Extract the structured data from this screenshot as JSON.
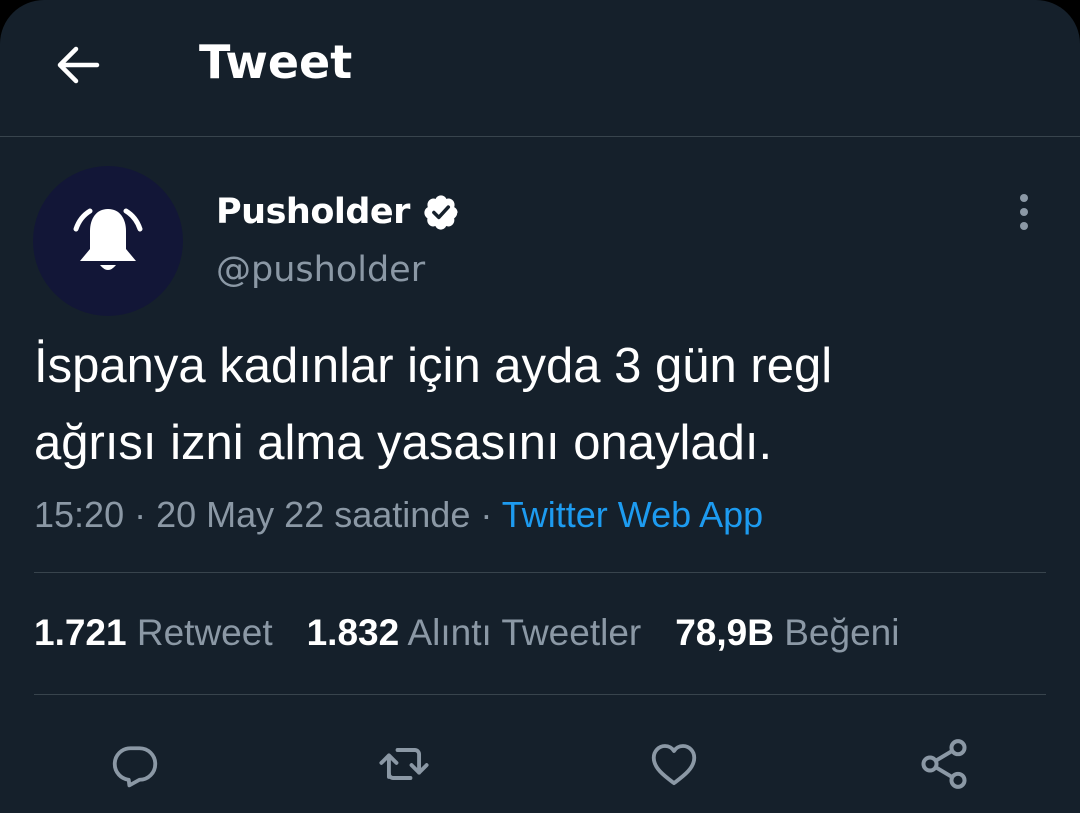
{
  "header": {
    "title": "Tweet",
    "back_icon": "arrow-left-icon"
  },
  "author": {
    "display_name": "Pusholder",
    "handle": "@pusholder",
    "verified": true,
    "avatar_icon": "bell-icon",
    "avatar_bg": "#121637"
  },
  "tweet": {
    "text_line1": "İspanya kadınlar için ayda 3 gün regl",
    "text_line2": "ağrısı izni alma yasasını onayladı.",
    "time": "15:20",
    "separator": "·",
    "date": "20 May 22 saatinde",
    "source": "Twitter Web App"
  },
  "stats": {
    "retweets_count": "1.721",
    "retweets_label": "Retweet",
    "quotes_count": "1.832",
    "quotes_label": "Alıntı Tweetler",
    "likes_count": "78,9B",
    "likes_label": "Beğeni"
  },
  "actions": [
    "reply-icon",
    "retweet-icon",
    "like-icon",
    "share-icon"
  ],
  "colors": {
    "background": "#15202b",
    "divider": "#38444d",
    "secondary_text": "#8b98a5",
    "accent": "#1d9bf0",
    "primary_text": "#ffffff"
  }
}
